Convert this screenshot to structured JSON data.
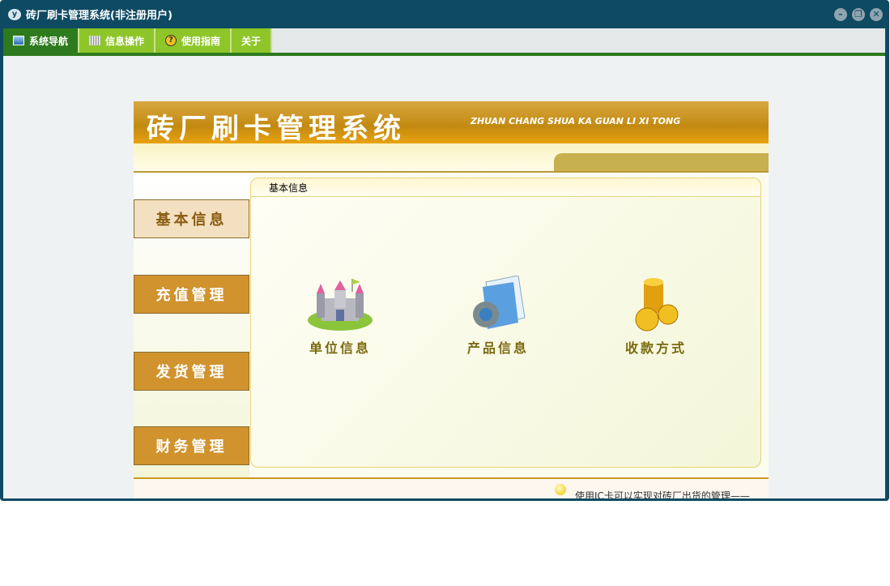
{
  "window": {
    "title": "砖厂刷卡管理系统(非注册用户)",
    "logo": "y"
  },
  "menu": [
    {
      "label": "系统导航",
      "icon": "monitor-icon"
    },
    {
      "label": "信息操作",
      "icon": "grid-icon"
    },
    {
      "label": "使用指南",
      "icon": "help-icon"
    },
    {
      "label": "关于"
    }
  ],
  "banner": {
    "title": "砖厂刷卡管理系统",
    "subtitle": "ZHUAN CHANG SHUA KA GUAN LI XI TONG"
  },
  "sidebar": [
    "基本信息",
    "充值管理",
    "发货管理",
    "财务管理"
  ],
  "content": {
    "tab": "基本信息",
    "items": [
      {
        "label": "单位信息",
        "icon": "castle-icon"
      },
      {
        "label": "产品信息",
        "icon": "gear-document-icon"
      },
      {
        "label": "收款方式",
        "icon": "coins-icon"
      }
    ]
  },
  "footer": {
    "text": "使用IC卡可以实现对砖厂出货的管理——"
  },
  "colors": {
    "titlebar": "#0e4a62",
    "menu_active": "#2e7a1e",
    "menu": "#8ec62a",
    "sidebar_button": "#d0932e"
  }
}
